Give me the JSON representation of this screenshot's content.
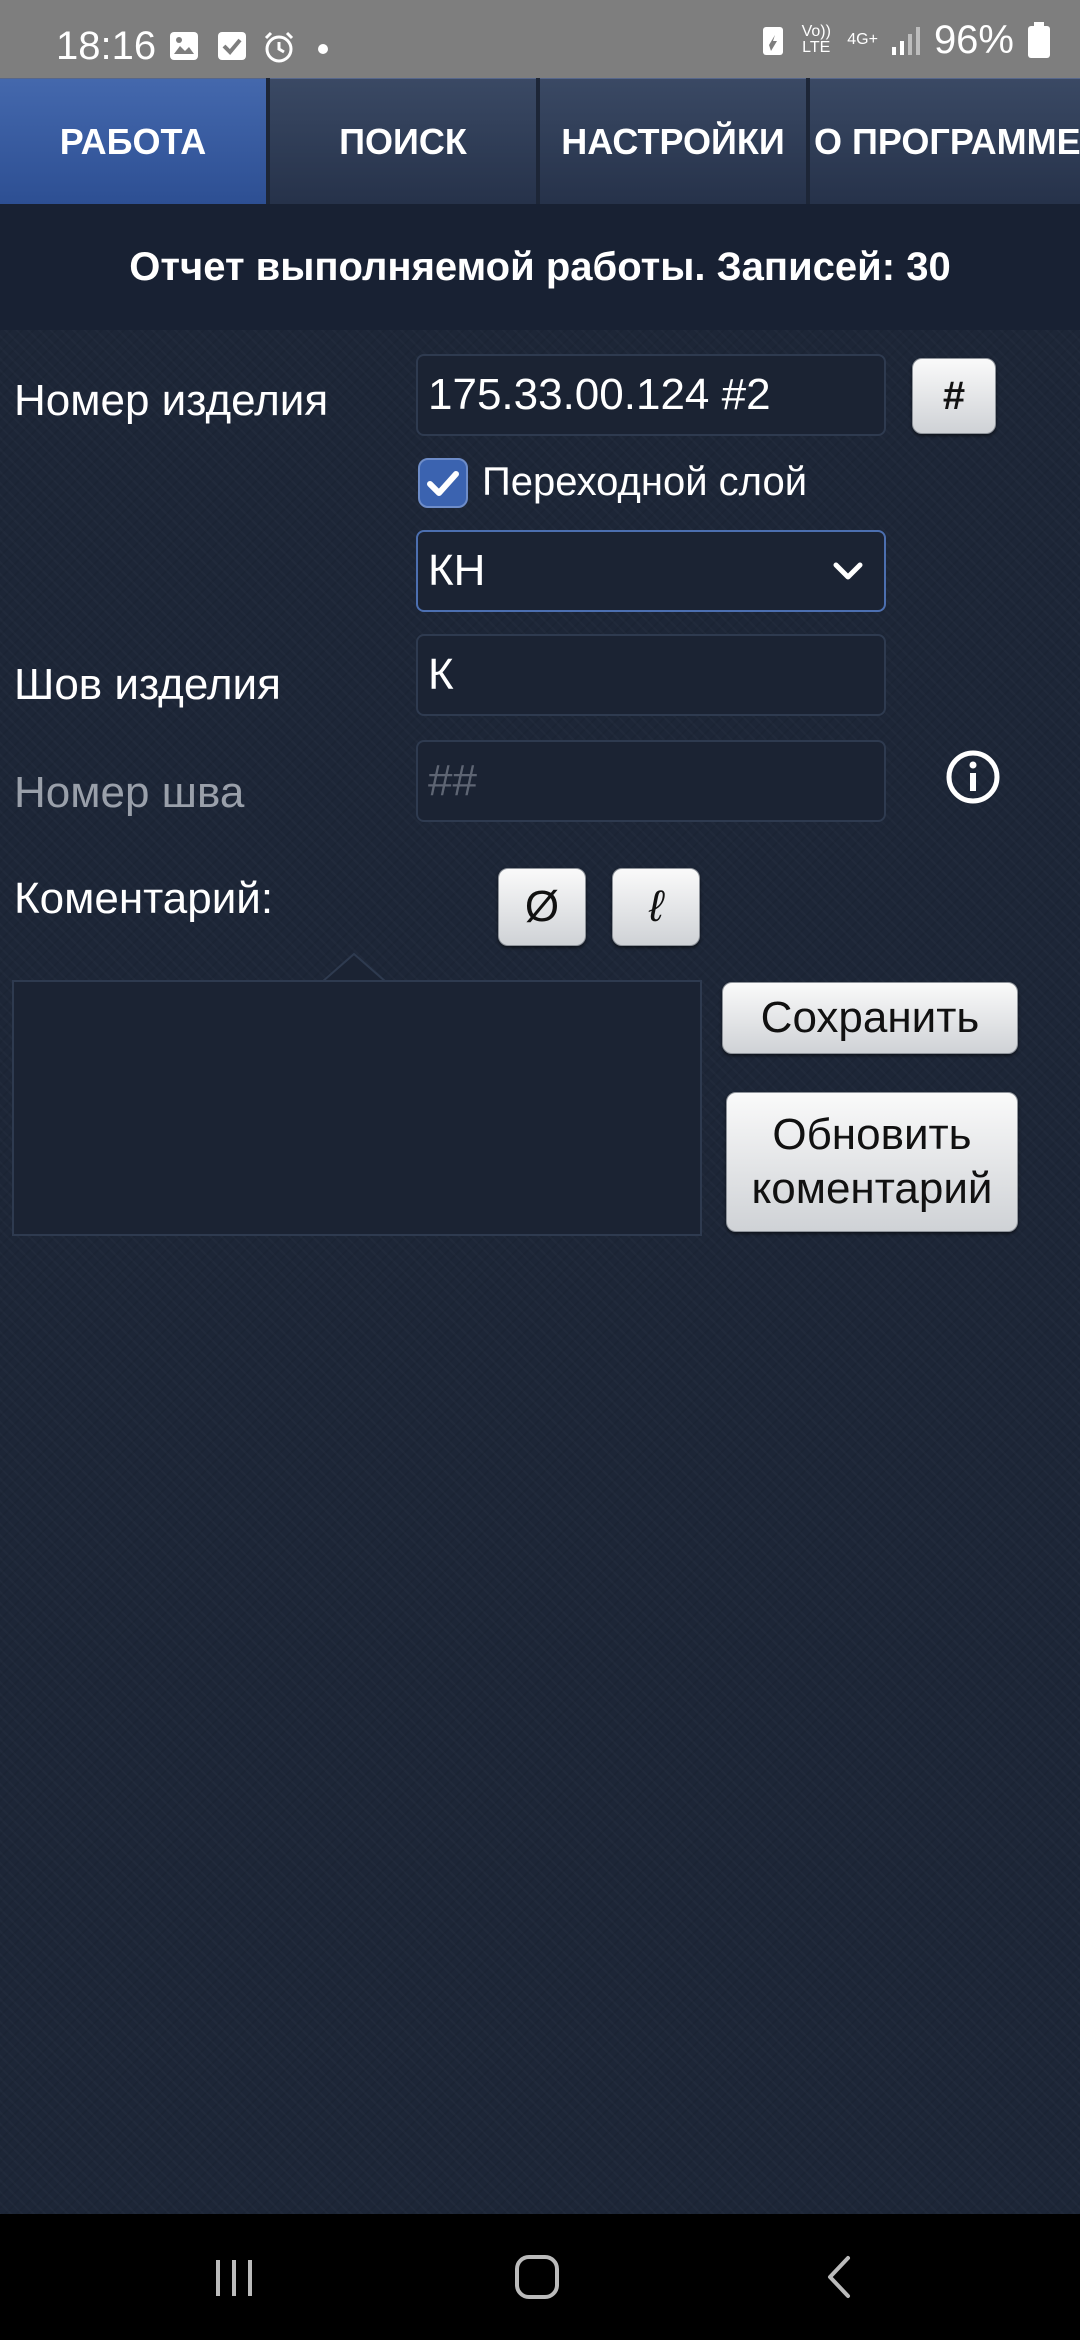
{
  "status_bar": {
    "time": "18:16",
    "battery": "96%",
    "network": "4G+",
    "volte": "Vo)) LTE"
  },
  "tabs": [
    {
      "label": "РАБОТА",
      "active": true
    },
    {
      "label": "ПОИСК",
      "active": false
    },
    {
      "label": "НАСТРОЙКИ",
      "active": false
    },
    {
      "label": "О ПРОГРАММЕ",
      "active": false
    }
  ],
  "header": {
    "title": "Отчет выполняемой работы. Записей: 30"
  },
  "form": {
    "item_number_label": "Номер изделия",
    "item_number_value": "175.33.00.124 #2",
    "hash_button": "#",
    "transition_layer_label": "Переходной слой",
    "transition_layer_checked": true,
    "layer_select_value": "КН",
    "seam_label": "Шов изделия",
    "seam_value": "К",
    "seam_number_label": "Номер шва",
    "seam_number_placeholder": "##",
    "comment_label": "Коментарий:",
    "diameter_button": "Ø",
    "script_l_button": "ℓ",
    "comment_value": "",
    "save_button": "Сохранить",
    "update_button_line1": "Обновить",
    "update_button_line2": "коментарий"
  },
  "colors": {
    "active_tab": "#3b5ea6",
    "background": "#1d2637",
    "checkbox": "#3b63b0"
  },
  "icons": [
    "image-icon",
    "check-icon",
    "alarm-icon",
    "info-icon",
    "chevron-down-icon",
    "recent-apps-icon",
    "home-icon",
    "back-icon"
  ]
}
